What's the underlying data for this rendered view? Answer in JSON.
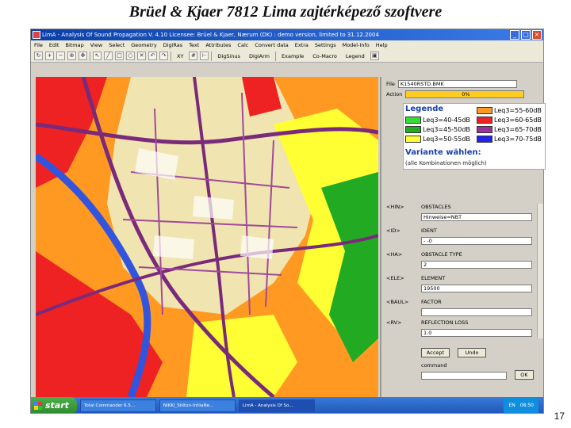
{
  "slide": {
    "title": "Brüel & Kjaer 7812 Lima zajtérképező szoftvere",
    "page_number": "17"
  },
  "window": {
    "title": "LimA - Analysis Of Sound Propagation    V. 4.10    Licensee: Brüel & Kjaer, Nærum (DK) : demo version, limited to 31.12.2004",
    "minimize": "_",
    "maximize": "□",
    "close": "×"
  },
  "menu": [
    "File",
    "Edit",
    "Bitmap",
    "View",
    "Select",
    "Geometry",
    "DigiRas",
    "Text",
    "Attributes",
    "Calc",
    "Convert data",
    "Extra",
    "Settings",
    "Model-Info",
    "Help"
  ],
  "toolbar": {
    "labels": [
      "XY",
      "DigSinus",
      "DigiArm",
      "Example",
      "Co-Macro",
      "Legend"
    ]
  },
  "panel": {
    "file_label": "File",
    "file_value": "K1540RSTD.BMK",
    "action_label": "Action",
    "action_value": "0%",
    "fields": [
      {
        "code": "<HIN>",
        "name": "OBSTACLES",
        "value": "Hinweise=NBT"
      },
      {
        "code": "<ID>",
        "name": "IDENT",
        "value": "-     -0"
      },
      {
        "code": "<HA>",
        "name": "OBSTACLE TYPE",
        "value": "2"
      },
      {
        "code": "<ELE>",
        "name": "ELEMENT",
        "value": "19500"
      },
      {
        "code": "<BAUL>",
        "name": "FACTOR",
        "value": ""
      },
      {
        "code": "<RV>",
        "name": "REFLECTION LOSS",
        "value": "1.0"
      }
    ],
    "accept": "Accept",
    "undo": "Undo",
    "command_label": "command",
    "ok": "OK"
  },
  "legend": {
    "title": "Legende",
    "items": [
      {
        "label": "Leq3=40-45dB",
        "color": "#33dd33"
      },
      {
        "label": "Leq3=45-50dB",
        "color": "#22aa22"
      },
      {
        "label": "Leq3=50-55dB",
        "color": "#ffff33"
      },
      {
        "label": "Leq3=55-60dB",
        "color": "#ff9922"
      },
      {
        "label": "Leq3=60-65dB",
        "color": "#ee2222"
      },
      {
        "label": "Leq3=65-70dB",
        "color": "#993399"
      },
      {
        "label": "Leq3=70-75dB",
        "color": "#2222ee"
      }
    ],
    "variant_title": "Variante wählen:",
    "variant_sub": "(alle Kombinationen möglich)"
  },
  "taskbar": {
    "start": "start",
    "tasks": [
      "Total Commander 6.5...",
      "NIKKI_Stilton-IntiiaNe...",
      "LimA - Analysis Of So..."
    ],
    "lang": "EN",
    "clock": "08:50"
  },
  "colors": {
    "map_background": "#f0e4b0",
    "road": "#7a2a7a",
    "water": "#3355dd"
  }
}
